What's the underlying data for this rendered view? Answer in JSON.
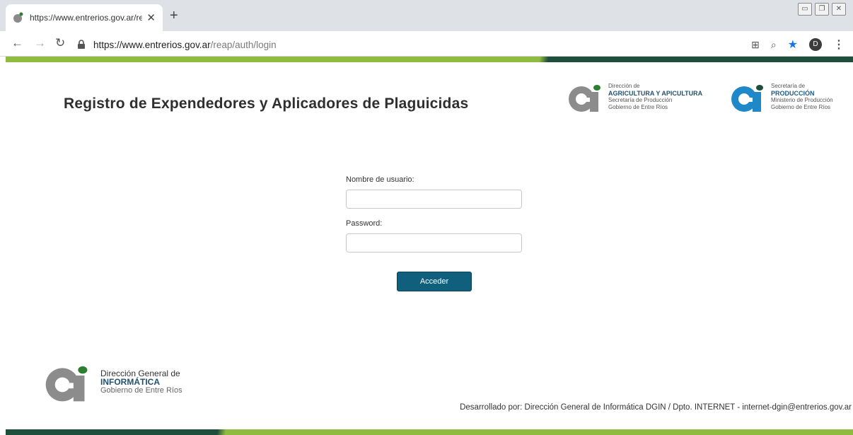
{
  "browser": {
    "tab_title": "https://www.entrerios.gov.ar/rea",
    "url_host": "https://www.entrerios.gov.ar",
    "url_path": "/reap/auth/login",
    "profile_initial": "D"
  },
  "header": {
    "title": "Registro de Expendedores y Aplicadores de Plaguicidas",
    "logo1": {
      "line1": "Dirección de",
      "line2": "AGRICULTURA Y APICULTURA",
      "line3": "Secretaría de Producción",
      "line4": "Gobierno de Entre Ríos"
    },
    "logo2": {
      "line1": "Secretaría de",
      "line2": "PRODUCCIÓN",
      "line3": "Ministerio de Producción",
      "line4": "Gobierno de Entre Ríos"
    }
  },
  "form": {
    "username_label": "Nombre de usuario:",
    "username_value": "",
    "password_label": "Password:",
    "password_value": "",
    "submit_label": "Acceder"
  },
  "footer": {
    "logo_line1": "Dirección General de",
    "logo_line2": "INFORMÁTICA",
    "logo_line3": "Gobierno de Entre Ríos",
    "credits": "Desarrollado por: Dirección General de Informática DGIN / Dpto. INTERNET - internet-dgin@entrerios.gov.ar"
  },
  "colors": {
    "accent_green": "#8fbb3f",
    "dark_green": "#1e4f3c",
    "button_blue": "#0f5f7d"
  }
}
